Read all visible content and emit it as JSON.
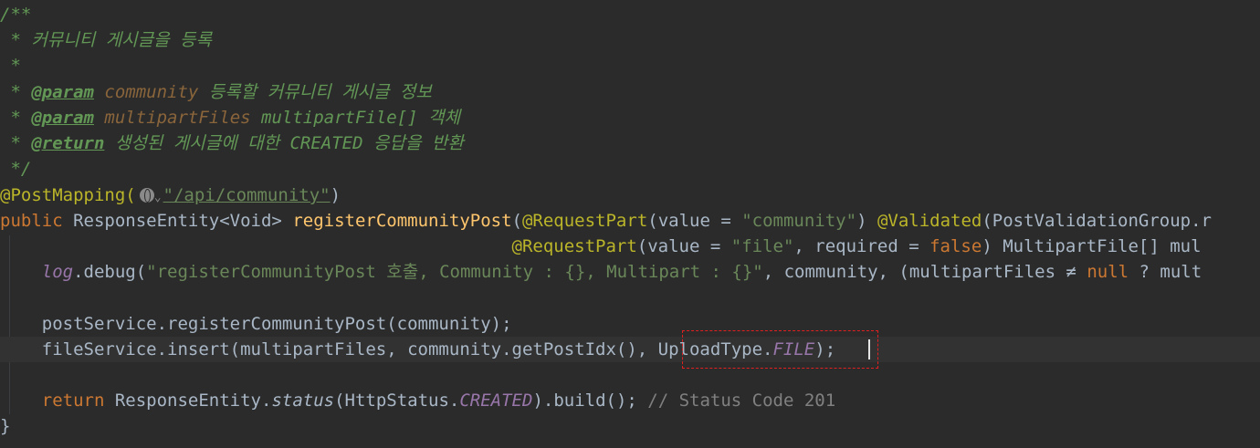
{
  "lines": [
    "/**",
    " * 커뮤니티 게시글을 등록",
    " *",
    {
      "pre": " * ",
      "tag": "@param",
      "name": "community",
      "desc": " 등록할 커뮤니티 게시글 정보"
    },
    {
      "pre": " * ",
      "tag": "@param",
      "name": "multipartFiles",
      "desc": " multipartFile[] 객체"
    },
    {
      "pre": " * ",
      "tag": "@return",
      "desc": " 생성된 게시글에 대한 CREATED 응답을 반환"
    },
    " */"
  ],
  "code": {
    "annotation": "@PostMapping(",
    "url": "\"/api/community\"",
    "annotation_close": ")",
    "sig1_kw": "public",
    "sig1_type": " ResponseEntity<Void> ",
    "sig1_fn": "registerCommunityPost",
    "sig1_rest_a": "(",
    "sig1_ann1": "@RequestPart",
    "sig1_rest_b": "(value = ",
    "sig1_str1": "\"community\"",
    "sig1_rest_c": ") ",
    "sig1_ann2": "@Validated",
    "sig1_rest_d": "(PostValidationGroup.r",
    "sig2_indent": "                                                 ",
    "sig2_ann": "@RequestPart",
    "sig2_a": "(value = ",
    "sig2_str": "\"file\"",
    "sig2_b": ", required = ",
    "sig2_kw": "false",
    "sig2_c": ") MultipartFile[] mul",
    "log_indent": "    ",
    "log_field": "log",
    "log_a": ".debug(",
    "log_str": "\"registerCommunityPost 호출, Community : {}, Multipart : {}\"",
    "log_b": ", community, (multipartFiles ≠ ",
    "log_kw": "null",
    "log_c": " ? mult",
    "post_line": "    postService.registerCommunityPost(community);",
    "file_a": "    fileService.insert(multipartFiles, community.getPostIdx(), UploadType.",
    "file_field": "FILE",
    "file_b": ");",
    "ret_indent": "    ",
    "ret_kw": "return",
    "ret_a": " ResponseEntity.",
    "ret_static": "status",
    "ret_b": "(HttpStatus.",
    "ret_field": "CREATED",
    "ret_c": ").build(); ",
    "ret_comment": "// Status Code 201",
    "close_brace": "}"
  },
  "icons": {
    "globe": "globe-icon",
    "chevron": "chevron-down-icon"
  }
}
